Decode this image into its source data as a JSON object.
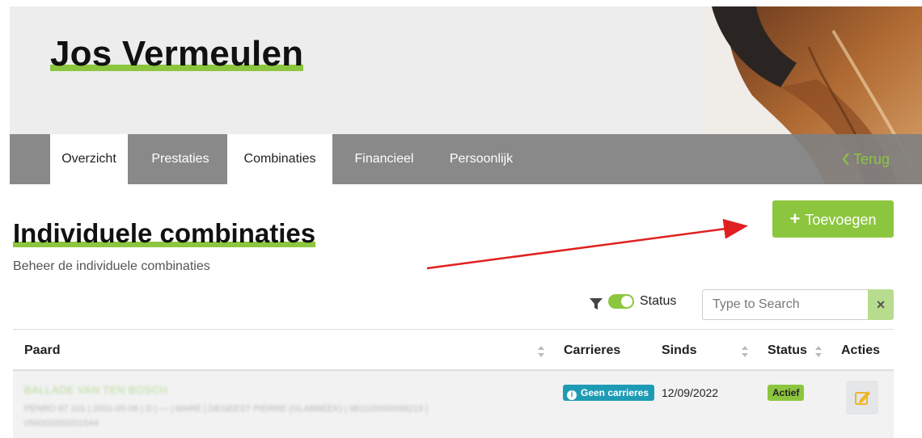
{
  "header": {
    "title": "Jos Vermeulen"
  },
  "nav": {
    "tabs": [
      {
        "label": "Overzicht",
        "active": true
      },
      {
        "label": "Prestaties",
        "active": false
      },
      {
        "label": "Combinaties",
        "active": true
      },
      {
        "label": "Financieel",
        "active": false
      },
      {
        "label": "Persoonlijk",
        "active": false
      }
    ],
    "back_label": "Terug"
  },
  "section": {
    "title": "Individuele combinaties",
    "subtitle": "Beheer de individuele combinaties",
    "add_label": "Toevoegen"
  },
  "filter": {
    "status_label": "Status",
    "status_enabled": true,
    "search_placeholder": "Type to Search",
    "clear_label": "×"
  },
  "table": {
    "columns": [
      "Paard",
      "Carrieres",
      "Sinds",
      "Status",
      "Acties"
    ],
    "rows": [
      {
        "horse_name": "BALLADE VAN TEN BOSCH",
        "horse_meta": "PENRO 87 101 | 2001-05-06 | D | — | MARE | DEGEEST PIERRE (GLABBEEK) | 981100000096219 | 056002000201544",
        "carrieres": "Geen carrieres",
        "sinds": "12/09/2022",
        "status": "Actief"
      }
    ]
  },
  "colors": {
    "accent": "#8cc63f",
    "nav_bg": "#808080",
    "info_badge": "#1e9bb4",
    "annotation_arrow": "#e02020"
  },
  "icons": [
    "chevron-left-icon",
    "plus-icon",
    "filter-icon",
    "toggle-switch",
    "close-icon",
    "sort-icon",
    "info-icon",
    "edit-icon"
  ]
}
